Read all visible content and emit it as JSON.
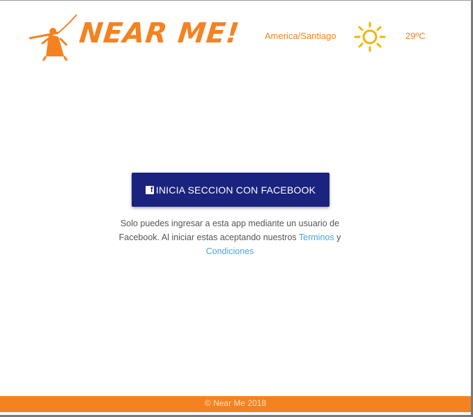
{
  "header": {
    "logo_text": "NEAR ME!",
    "timezone": "America/Santiago",
    "temperature": "29ºC",
    "weather_icon": "sun-icon"
  },
  "login": {
    "button_icon": "facebook-icon",
    "button_icon_glyph": "f",
    "button_label": "INICIA SECCION CON FACEBOOK",
    "notice_text": "Solo puedes ingresar a esta app mediante un usuario de Facebook. Al iniciar estas aceptando nuestros",
    "terms_link": "Terminos",
    "conjunction": "y",
    "conditions_link": "Condiciones"
  },
  "footer": {
    "copyright": "© Near Me 2018"
  },
  "colors": {
    "brand_orange": "#f58220",
    "facebook_button": "#1a237e",
    "link_blue": "#4aa3df"
  }
}
